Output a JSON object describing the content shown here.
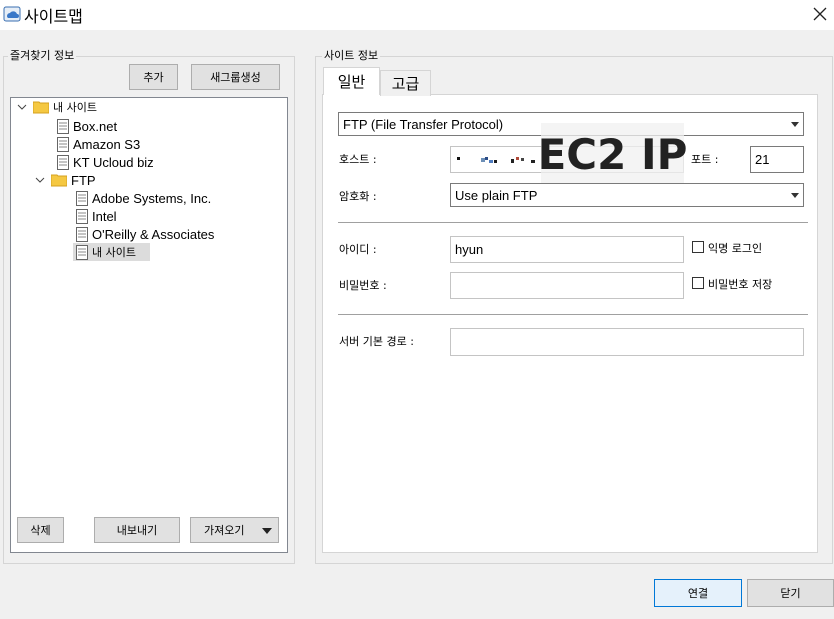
{
  "window": {
    "title": "사이트맵"
  },
  "favorites": {
    "group_label": "즐겨찾기 정보",
    "add_label": "추가",
    "new_folder_label": "새그룹생성",
    "tree": [
      {
        "label": "내 사이트",
        "type": "folder"
      },
      {
        "label": "Box.net",
        "type": "site"
      },
      {
        "label": "Amazon S3",
        "type": "site"
      },
      {
        "label": "KT Ucloud biz",
        "type": "site"
      },
      {
        "label": "FTP",
        "type": "folder"
      },
      {
        "label": "Adobe Systems, Inc.",
        "type": "site"
      },
      {
        "label": "Intel",
        "type": "site"
      },
      {
        "label": "O'Reilly & Associates",
        "type": "site"
      },
      {
        "label": "내 사이트",
        "type": "site",
        "selected": true
      }
    ],
    "delete_label": "삭제",
    "export_label": "내보내기",
    "import_label": "가져오기"
  },
  "site_info": {
    "group_label": "사이트 정보",
    "tabs": [
      "일반",
      "고급"
    ],
    "protocol": "FTP (File Transfer Protocol)",
    "host_label": "호스트 :",
    "host_overlay": "EC2 IP",
    "port_label": "포트 :",
    "port_value": "21",
    "encryption_label": "암호화 :",
    "encryption_value": "Use plain FTP",
    "id_label": "아이디 :",
    "id_value": "hyun",
    "anonymous_label": "익명 로그인",
    "password_label": "비밀번호 :",
    "password_value": "",
    "save_password_label": "비밀번호 저장",
    "remote_path_label": "서버 기본 경로 :",
    "remote_path_value": ""
  },
  "footer": {
    "connect_label": "연결",
    "close_label": "닫기"
  }
}
